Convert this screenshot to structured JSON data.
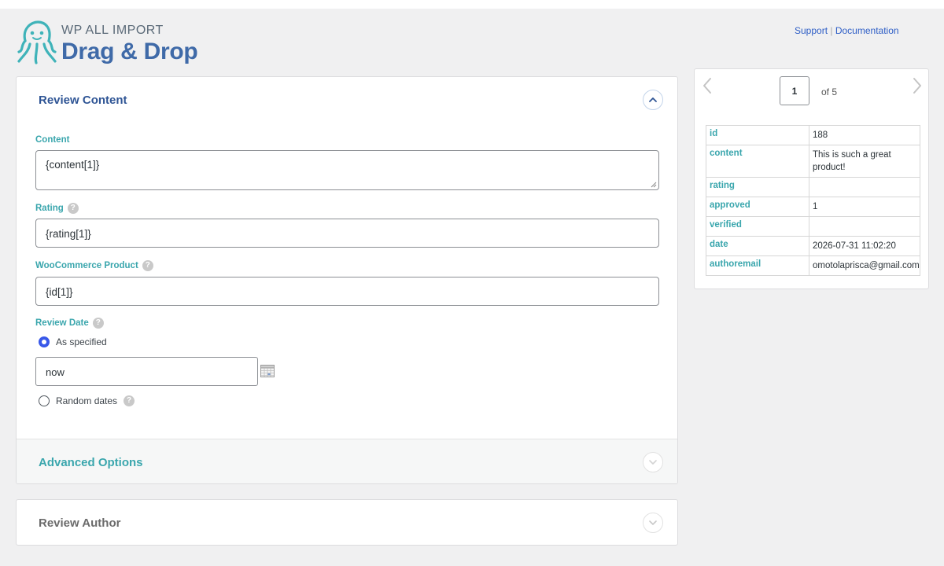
{
  "header": {
    "brand_small": "WP ALL IMPORT",
    "brand_big": "Drag & Drop",
    "support_link": "Support",
    "separator": "|",
    "documentation_link": "Documentation",
    "logo_icon": "octopus-icon",
    "brand_color": "#3f6aa8",
    "accent_color": "#3aa6ad"
  },
  "review_content": {
    "title": "Review Content",
    "content_label": "Content",
    "content_value": "{content[1]}",
    "rating_label": "Rating",
    "rating_value": "{rating[1]}",
    "product_label": "WooCommerce Product",
    "product_value": "{id[1]}",
    "date_label": "Review Date",
    "date_option_specified": "As specified",
    "date_value": "now",
    "date_option_random": "Random dates",
    "selected_date_option": "As specified"
  },
  "advanced": {
    "title": "Advanced Options"
  },
  "author": {
    "title": "Review Author"
  },
  "preview": {
    "page": "1",
    "of_text": "of 5",
    "rows": [
      {
        "key": "id",
        "value": "188"
      },
      {
        "key": "content",
        "value": "This is such a great product!"
      },
      {
        "key": "rating",
        "value": ""
      },
      {
        "key": "approved",
        "value": "1"
      },
      {
        "key": "verified",
        "value": ""
      },
      {
        "key": "date",
        "value": "2026-07-31 11:02:20"
      },
      {
        "key": "authoremail",
        "value": "omotolaprisca@gmail.com"
      }
    ]
  }
}
